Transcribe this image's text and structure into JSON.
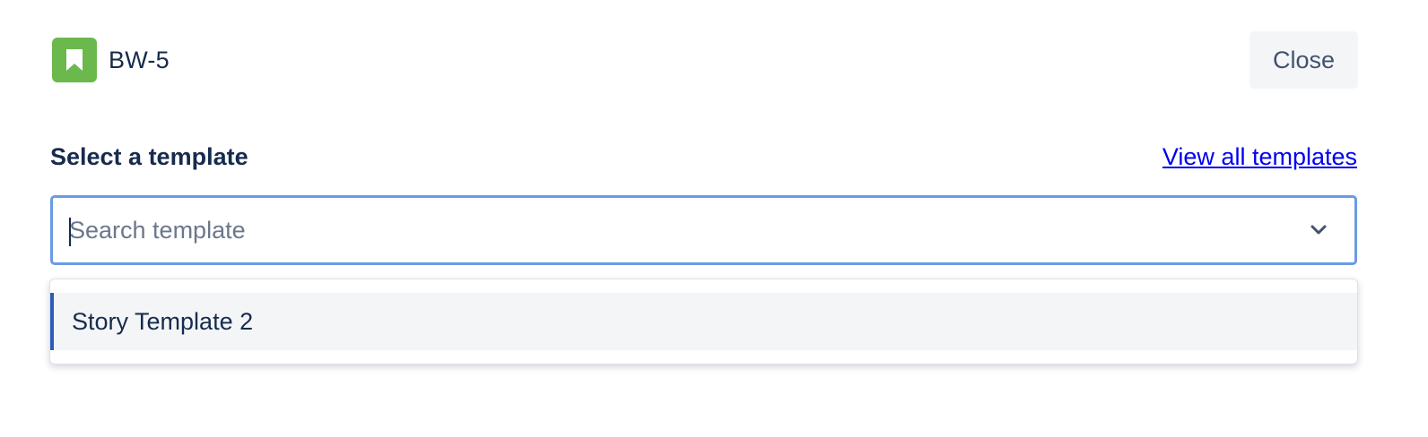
{
  "issue": {
    "key": "BW-5",
    "icon": "bookmark-icon",
    "icon_color": "#6BB84D"
  },
  "header": {
    "close_label": "Close"
  },
  "template_picker": {
    "label": "Select a template",
    "view_all_label": "View all templates",
    "search_placeholder": "Search template",
    "search_value": "",
    "options": [
      {
        "label": "Story Template 2",
        "highlighted": true
      }
    ]
  },
  "colors": {
    "focus_border": "#6A9BE3",
    "link": "#0000EE",
    "option_highlight_bar": "#2E5BBB",
    "text_primary": "#172B4D"
  }
}
